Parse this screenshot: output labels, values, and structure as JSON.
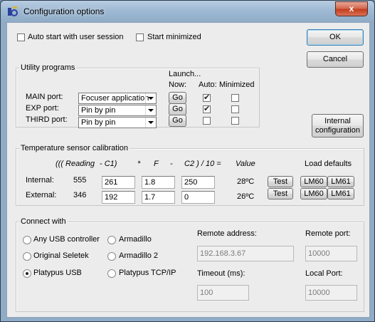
{
  "window": {
    "title": "Configuration options",
    "close_symbol": "x"
  },
  "top": {
    "auto_start_label": "Auto start with user session",
    "auto_start_checked": false,
    "start_minimized_label": "Start minimized",
    "start_minimized_checked": false
  },
  "buttons": {
    "ok": "OK",
    "cancel": "Cancel",
    "internal_config_line1": "Internal",
    "internal_config_line2": "configuration"
  },
  "utility": {
    "title": "Utility programs",
    "launch_label": "Launch...",
    "now_label": "Now:",
    "auto_label": "Auto:",
    "minimized_label": "Minimized",
    "go_label": "Go",
    "ports": [
      {
        "label": "MAIN port:",
        "program": "Focuser application",
        "auto": true,
        "minimized": false
      },
      {
        "label": "EXP port:",
        "program": "Pin by pin",
        "auto": true,
        "minimized": false
      },
      {
        "label": "THIRD port:",
        "program": "Pin by pin",
        "auto": false,
        "minimized": false
      }
    ]
  },
  "temperature": {
    "title": "Temperature sensor calibration",
    "formula": {
      "reading": "((( Reading",
      "c1": "-   C1)",
      "times": "*",
      "f": "F",
      "minus": "-",
      "c2": "C2 ) / 10 =",
      "value": "Value"
    },
    "load_defaults_label": "Load defaults",
    "test_label": "Test",
    "lm60_label": "LM60",
    "lm61_label": "LM61",
    "rows": [
      {
        "label": "Internal:",
        "reading": "555",
        "c1": "261",
        "f": "1.8",
        "c2": "250",
        "value": "28ºC"
      },
      {
        "label": "External:",
        "reading": "346",
        "c1": "192",
        "f": "1.7",
        "c2": "0",
        "value": "26ºC"
      }
    ]
  },
  "connect": {
    "title": "Connect with",
    "options": [
      {
        "label": "Any USB controller",
        "selected": false
      },
      {
        "label": "Armadillo",
        "selected": false
      },
      {
        "label": "Original Seletek",
        "selected": false
      },
      {
        "label": "Armadillo 2",
        "selected": false
      },
      {
        "label": "Platypus USB",
        "selected": true
      },
      {
        "label": "Platypus TCP/IP",
        "selected": false
      }
    ],
    "remote_address_label": "Remote address:",
    "remote_address_value": "192.168.3.67",
    "remote_port_label": "Remote port:",
    "remote_port_value": "10000",
    "timeout_label": "Timeout (ms):",
    "timeout_value": "100",
    "local_port_label": "Local Port:",
    "local_port_value": "10000"
  }
}
